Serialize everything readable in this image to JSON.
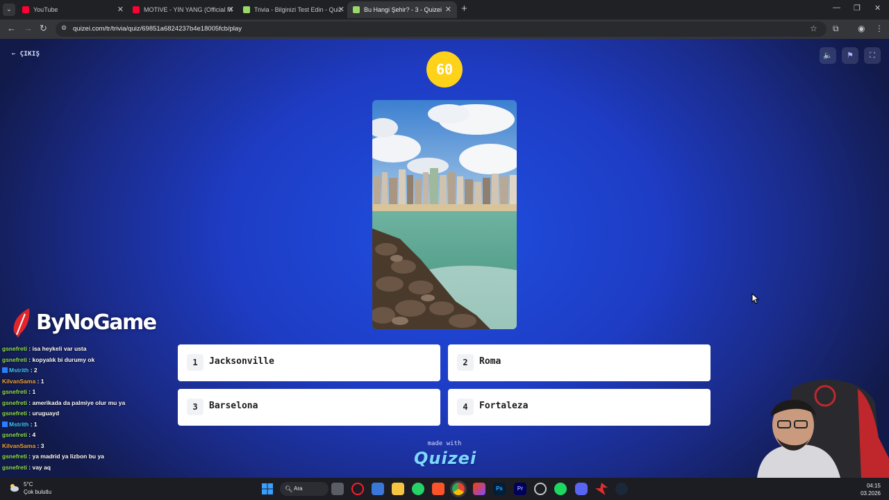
{
  "browser": {
    "tabs": [
      {
        "title": "YouTube",
        "favicon_color": "#ff0033"
      },
      {
        "title": "MOTIVE - YIN YANG (Official M",
        "favicon_color": "#ff0033"
      },
      {
        "title": "Trivia - Bilginizi Test Edin - Quiz",
        "favicon_color": "#9bd86a"
      },
      {
        "title": "Bu Hangi Şehir? - 3 - Quizei",
        "favicon_color": "#9bd86a"
      }
    ],
    "url": "quizei.com/tr/trivia/quiz/69851a6824237b4e18005fcb/play"
  },
  "quiz": {
    "exit_label": "ÇIKIŞ",
    "timer": "60",
    "answers": [
      {
        "number": "1",
        "text": "Jacksonville"
      },
      {
        "number": "2",
        "text": "Roma"
      },
      {
        "number": "3",
        "text": "Barselona"
      },
      {
        "number": "4",
        "text": "Fortaleza"
      }
    ],
    "footer_made_with": "made with",
    "footer_brand": "Quizei"
  },
  "overlay": {
    "logo_text": "ByNoGame",
    "chat": [
      {
        "user": "gsnefreti",
        "msg": "isa heykeli var usta",
        "color": "green",
        "badge": false
      },
      {
        "user": "gsnefreti",
        "msg": "kopyalık bi durumy ok",
        "color": "green",
        "badge": false
      },
      {
        "user": "Mstrith",
        "msg": "2",
        "color": "cyan",
        "badge": true
      },
      {
        "user": "KilvanSama",
        "msg": "1",
        "color": "orange",
        "badge": false
      },
      {
        "user": "gsnefreti",
        "msg": "1",
        "color": "green",
        "badge": false
      },
      {
        "user": "gsnefreti",
        "msg": "amerikada da palmiye olur mu ya",
        "color": "green",
        "badge": false
      },
      {
        "user": "gsnefreti",
        "msg": "uruguayd",
        "color": "green",
        "badge": false
      },
      {
        "user": "Mstrith",
        "msg": "1",
        "color": "cyan",
        "badge": true
      },
      {
        "user": "gsnefreti",
        "msg": "4",
        "color": "green",
        "badge": false
      },
      {
        "user": "KilvanSama",
        "msg": "3",
        "color": "orange",
        "badge": false
      },
      {
        "user": "gsnefreti",
        "msg": "ya madrid ya lizbon bu ya",
        "color": "green",
        "badge": false
      },
      {
        "user": "gsnefreti",
        "msg": "vay aq",
        "color": "green",
        "badge": false
      }
    ]
  },
  "taskbar": {
    "temperature": "5°C",
    "weather": "Çok bulutlu",
    "search_label": "Ara",
    "time": "04:15",
    "date": "03.2026"
  }
}
